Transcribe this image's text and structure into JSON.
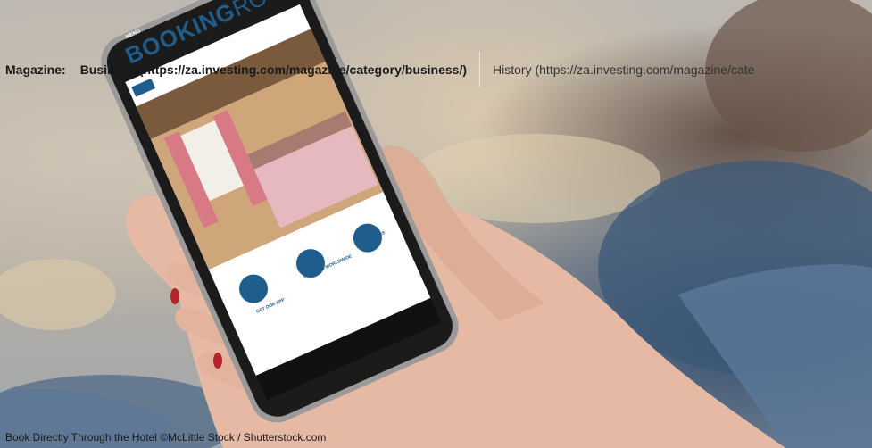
{
  "header": {
    "magazine_label": "Magazine:",
    "links": [
      {
        "label": "Business (https://za.investing.com/magazine/category/business/)"
      },
      {
        "label": "History (https://za.investing.com/magazine/cate"
      }
    ]
  },
  "phone_screen": {
    "logo_prefix": "BOOKING",
    "logo_suffix": "ROOM",
    "menu_tag": "MENU",
    "features": [
      {
        "icon": "phone-icon",
        "title": "GET OUR APP"
      },
      {
        "icon": "globe-icon",
        "title": "IN ROOMS WORLDWIDE"
      },
      {
        "icon": "cart-icon",
        "title": "OFFERS"
      }
    ]
  },
  "caption": "Book Directly Through the Hotel ©McLittle Stock / Shutterstock.com",
  "colors": {
    "accent_blue": "#1f5d8c",
    "text_dark": "#1a1a1a"
  }
}
